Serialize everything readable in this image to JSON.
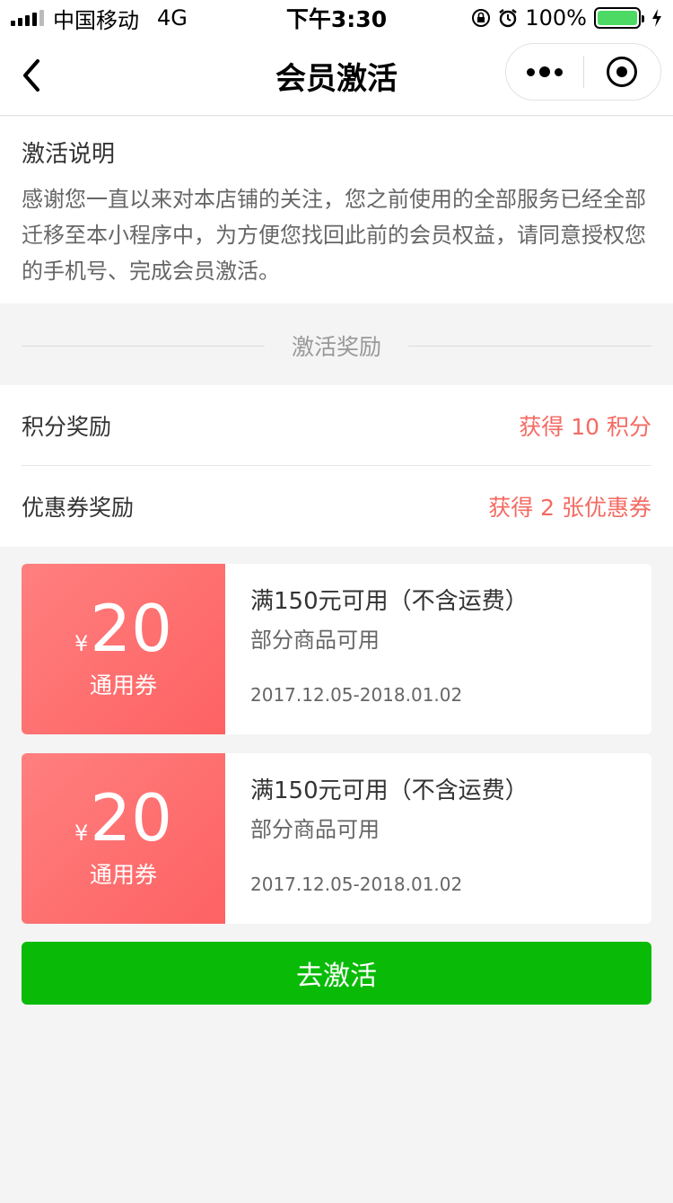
{
  "status_bar": {
    "carrier": "中国移动",
    "network": "4G",
    "time": "下午3:30",
    "battery": "100%"
  },
  "nav": {
    "title": "会员激活"
  },
  "explain": {
    "title": "激活说明",
    "body": "感谢您一直以来对本店铺的关注，您之前使用的全部服务已经全部迁移至本小程序中，为方便您找回此前的会员权益，请同意授权您的手机号、完成会员激活。"
  },
  "rewards_section": {
    "title": "激活奖励",
    "items": [
      {
        "label": "积分奖励",
        "value": "获得 10 积分"
      },
      {
        "label": "优惠券奖励",
        "value": "获得 2 张优惠券"
      }
    ]
  },
  "coupons": [
    {
      "currency": "¥",
      "amount": "20",
      "type": "通用券",
      "condition": "满150元可用（不含运费）",
      "scope": "部分商品可用",
      "validity": "2017.12.05-2018.01.02"
    },
    {
      "currency": "¥",
      "amount": "20",
      "type": "通用券",
      "condition": "满150元可用（不含运费）",
      "scope": "部分商品可用",
      "validity": "2017.12.05-2018.01.02"
    }
  ],
  "action": {
    "label": "去激活"
  },
  "colors": {
    "accent_red": "#f46a62",
    "coupon_red": "#fe6263",
    "button_green": "#09bb07"
  }
}
